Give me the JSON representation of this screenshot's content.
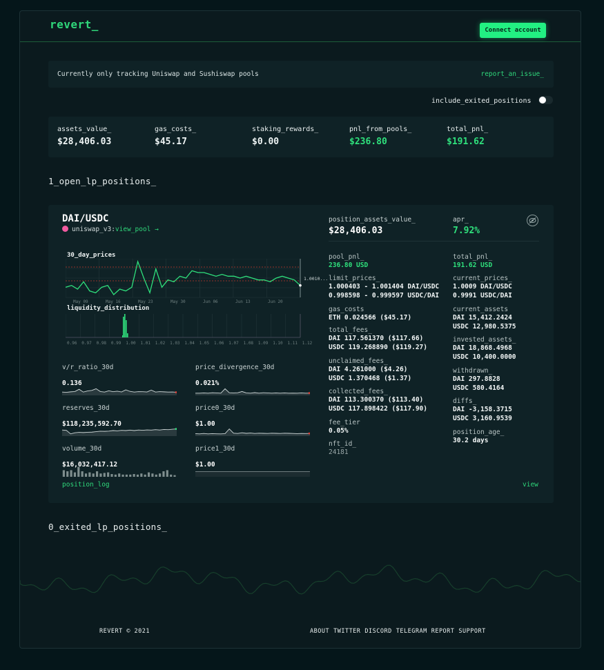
{
  "app": {
    "logo": "revert_",
    "connect_label": "Connect account"
  },
  "notice": {
    "text": "Currently only tracking Uniswap and Sushiswap pools",
    "link": "report_an_issue_"
  },
  "toggle": {
    "label": "include_exited_positions",
    "on": false
  },
  "stats": [
    {
      "label": "assets_value_",
      "value": "$28,406.03",
      "green": false
    },
    {
      "label": "gas_costs_",
      "value": "$45.17",
      "green": false
    },
    {
      "label": "staking_rewards_",
      "value": "$0.00",
      "green": false
    },
    {
      "label": "pnl_from_pools_",
      "value": "$236.80",
      "green": true
    },
    {
      "label": "total_pnl_",
      "value": "$191.62",
      "green": true
    }
  ],
  "sections": {
    "open": "1_open_lp_positions_",
    "exited": "0_exited_lp_positions_"
  },
  "position": {
    "pair": "DAI/USDC",
    "pool_prefix": "uniswap_v3:",
    "pool_link": "view_pool →",
    "assets_value_label": "position_assets_value_",
    "assets_value": "$28,406.03",
    "apr_label": "apr_",
    "apr": "7.92%",
    "eye_icon": "eye-off-icon",
    "price_chart": {
      "title": "30_day_prices",
      "current_label": "1.0010...",
      "x_ticks": [
        "May 09",
        "May 16",
        "May 23",
        "May 30",
        "Jun 06",
        "Jun 13",
        "Jun 20"
      ],
      "series": [
        0.9998,
        0.9999,
        0.9997,
        1.0001,
        0.9996,
        0.9995,
        0.9998,
        0.9999,
        0.9994,
        0.9997,
        0.9996,
        0.9998,
        1.0012,
        1.0003,
        0.9995,
        1.0008,
        0.9998,
        1.0002,
        1.0001,
        1.0004,
        1.0003,
        1.0007,
        1.0006,
        1.0006,
        1.0005,
        1.0004,
        1.0005,
        1.0004,
        1.0004,
        1.0003,
        1.0004,
        1.0003,
        1.0002,
        1.0002,
        1.0001,
        1.0003,
        1.0004,
        1.0003,
        1.0002,
        0.9999
      ]
    },
    "liquidity_chart": {
      "title": "liquidity_distribution",
      "x_ticks": [
        "0.96",
        "0.97",
        "0.98",
        "0.99",
        "1.00",
        "1.01",
        "1.02",
        "1.03",
        "1.04",
        "1.05",
        "1.06",
        "1.07",
        "1.08",
        "1.09",
        "1.10",
        "1.11",
        "1.12"
      ]
    },
    "minis": [
      {
        "label": "v/r_ratio_30d",
        "value": "0.136",
        "type": "area",
        "series": [
          0.3,
          0.28,
          0.32,
          0.35,
          0.55,
          0.3,
          0.4,
          0.45,
          0.6,
          0.35,
          0.3,
          0.42,
          0.33,
          0.38,
          0.31,
          0.5,
          0.36,
          0.3,
          0.34,
          0.33,
          0.31,
          0.48,
          0.3,
          0.34,
          0.32,
          0.3,
          0.31,
          0.28
        ]
      },
      {
        "label": "price_divergence_30d",
        "value": "0.021%",
        "type": "area",
        "series": [
          0.2,
          0.2,
          0.22,
          0.2,
          0.24,
          0.22,
          0.2,
          0.6,
          0.24,
          0.22,
          0.24,
          0.35,
          0.22,
          0.2,
          0.25,
          0.2,
          0.24,
          0.22,
          0.2,
          0.22,
          0.2,
          0.22,
          0.2,
          0.21,
          0.2,
          0.22,
          0.2,
          0.21
        ]
      },
      {
        "label": "reserves_30d",
        "value": "$118,235,592.70",
        "type": "area",
        "series": [
          0.55,
          0.52,
          0.2,
          0.3,
          0.34,
          0.32,
          0.35,
          0.36,
          0.4,
          0.44,
          0.43,
          0.45,
          0.5,
          0.47,
          0.52,
          0.5,
          0.54,
          0.5,
          0.55,
          0.53,
          0.56,
          0.54,
          0.58,
          0.55,
          0.6,
          0.58,
          0.62,
          0.65
        ]
      },
      {
        "label": "price0_30d",
        "value": "$1.00",
        "type": "area",
        "series": [
          0.22,
          0.2,
          0.24,
          0.2,
          0.22,
          0.21,
          0.2,
          0.22,
          0.65,
          0.26,
          0.24,
          0.3,
          0.25,
          0.28,
          0.24,
          0.26,
          0.25,
          0.24,
          0.26,
          0.25,
          0.24,
          0.26,
          0.25,
          0.24,
          0.22,
          0.24,
          0.23,
          0.24
        ]
      },
      {
        "label": "volume_30d",
        "value": "$16,032,417.12",
        "type": "bars",
        "series": [
          0.6,
          0.5,
          0.6,
          0.4,
          0.9,
          0.5,
          0.3,
          0.4,
          0.3,
          0.5,
          0.3,
          0.35,
          0.4,
          0.25,
          0.2,
          0.3,
          0.2,
          0.2,
          0.2,
          0.25,
          0.2,
          0.3,
          0.2,
          0.4,
          0.3,
          0.2,
          0.3,
          0.5,
          0.6,
          0.2,
          0.15
        ]
      },
      {
        "label": "price1_30d",
        "value": "$1.00",
        "type": "line",
        "series": [
          0.5,
          0.5,
          0.5,
          0.5,
          0.5,
          0.5,
          0.5,
          0.5,
          0.5,
          0.5,
          0.5,
          0.5,
          0.5,
          0.5,
          0.5,
          0.5,
          0.5,
          0.5,
          0.5,
          0.5
        ]
      }
    ],
    "info_left": [
      {
        "label": "pool_pnl_",
        "lines": [
          "236.80 USD"
        ],
        "style": "g"
      },
      {
        "label": "limit_prices_",
        "lines": [
          "1.000403 - 1.001404 DAI/USDC",
          "0.998598 - 0.999597 USDC/DAI"
        ],
        "style": ""
      },
      {
        "label": "gas_costs",
        "lines": [
          "ETH 0.024566 ($45.17)"
        ],
        "style": ""
      },
      {
        "label": "total_fees_",
        "lines": [
          "DAI 117.561370 ($117.66)",
          "USDC 119.268890 ($119.27)"
        ],
        "style": ""
      },
      {
        "label": "unclaimed_fees_",
        "lines": [
          "DAI 4.261000 ($4.26)",
          "USDC 1.370468 ($1.37)"
        ],
        "style": ""
      },
      {
        "label": "collected_fees_",
        "lines": [
          "DAI 113.300370 ($113.40)",
          "USDC 117.898422 ($117.90)"
        ],
        "style": ""
      },
      {
        "label": "fee_tier",
        "lines": [
          "0.05%"
        ],
        "style": ""
      },
      {
        "label": "nft_id_",
        "lines": [
          "24181"
        ],
        "style": "d"
      }
    ],
    "info_right": [
      {
        "label": "total_pnl_",
        "lines": [
          "191.62 USD"
        ],
        "style": "g"
      },
      {
        "label": "current_prices_",
        "lines": [
          "1.0009 DAI/USDC",
          "0.9991 USDC/DAI"
        ],
        "style": ""
      },
      {
        "label": "current_assets",
        "lines": [
          "DAI 15,412.2424",
          "USDC 12,980.5375"
        ],
        "style": ""
      },
      {
        "label": "invested_assets_",
        "lines": [
          "DAI 18,868.4968",
          "USDC 10,400.0000"
        ],
        "style": ""
      },
      {
        "label": "withdrawn_",
        "lines": [
          "DAI 297.8828",
          "USDC 580.4164"
        ],
        "style": ""
      },
      {
        "label": "diffs_",
        "lines": [
          "DAI -3,158.3715",
          "USDC 3,160.9539"
        ],
        "style": ""
      },
      {
        "label": "position_age_",
        "lines": [
          "30.2 days"
        ],
        "style": ""
      }
    ],
    "position_log": "position_log",
    "view": "view"
  },
  "footer": {
    "copyright": "REVERT © 2021",
    "links": [
      "ABOUT",
      "TWITTER",
      "DISCORD",
      "TELEGRAM",
      "REPORT",
      "SUPPORT"
    ]
  },
  "colors": {
    "accent": "#22f082",
    "bg": "#05161a",
    "card": "#0f2226"
  }
}
